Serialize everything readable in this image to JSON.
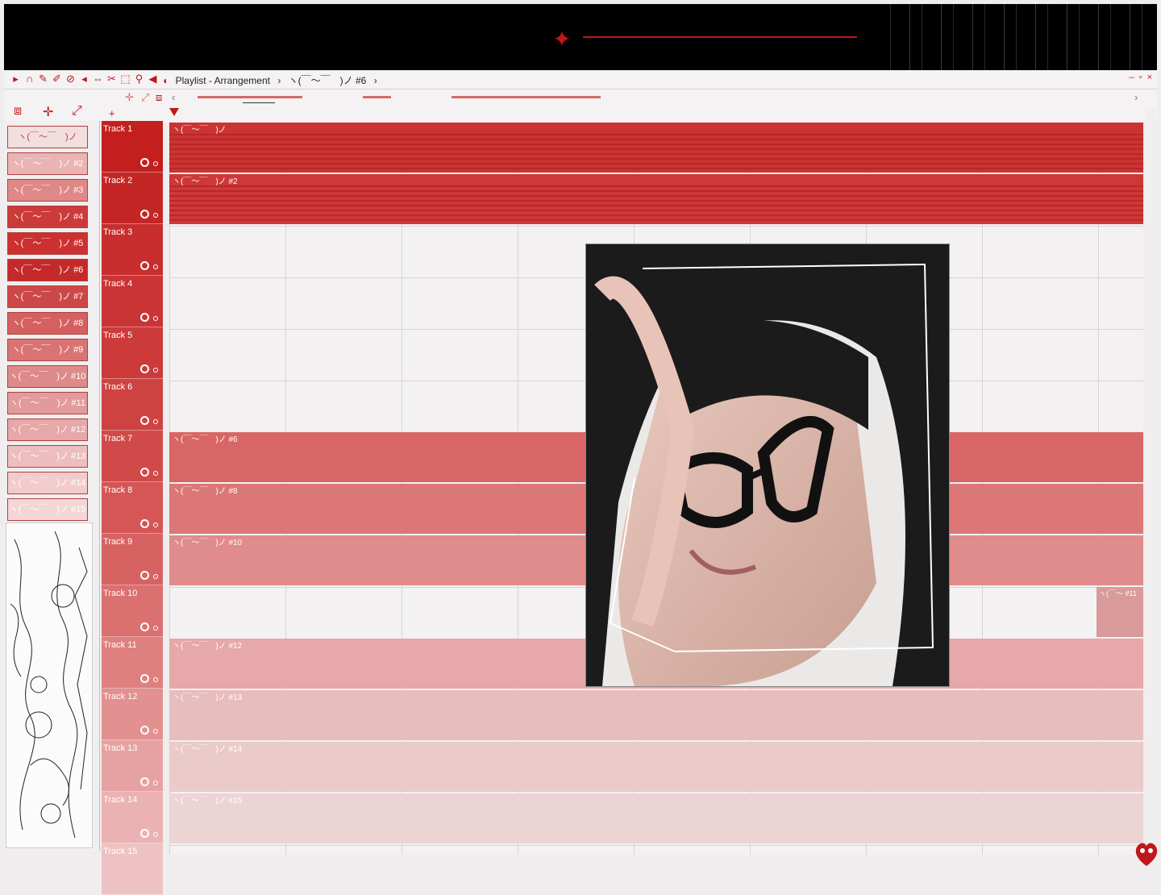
{
  "window": {
    "breadcrumb": [
      "Playlist - Arrangement",
      "›",
      "ヽ(￣～￣　)ノ #6",
      "›"
    ],
    "controls": [
      "–",
      "▫",
      "×"
    ]
  },
  "patterns": [
    {
      "label": "ヽ(￣～￣　)ノ",
      "color": "#f2dede"
    },
    {
      "label": "ヽ(￣～￣　)ノ #2",
      "color": "#eab4b4"
    },
    {
      "label": "ヽ(￣～￣　)ノ #3",
      "color": "#e08888"
    },
    {
      "label": "ヽ(￣～￣　)ノ #4",
      "color": "#cc3a3a"
    },
    {
      "label": "ヽ(￣～￣　)ノ #5",
      "color": "#cc3030"
    },
    {
      "label": "ヽ(￣～￣　)ノ #6",
      "color": "#c42a2a"
    },
    {
      "label": "ヽ(￣～￣　)ノ #7",
      "color": "#cc4848"
    },
    {
      "label": "ヽ(￣～￣　)ノ #8",
      "color": "#d46060"
    },
    {
      "label": "ヽ(￣～￣　)ノ #9",
      "color": "#da7474"
    },
    {
      "label": "ヽ(￣～￣　)ノ #10",
      "color": "#de8a8a"
    },
    {
      "label": "ヽ(￣～￣　)ノ #11",
      "color": "#e29a9a"
    },
    {
      "label": "ヽ(￣～￣　)ノ #12",
      "color": "#e6a8a8"
    },
    {
      "label": "ヽ(￣～￣　)ノ #13",
      "color": "#eebebe"
    },
    {
      "label": "ヽ(￣～￣　)ノ #14",
      "color": "#f2cccc"
    },
    {
      "label": "ヽ(￣～￣　)ノ #15",
      "color": "#f4d6d6"
    }
  ],
  "tracks": [
    {
      "label": "Track 1",
      "color": "#c41f1f"
    },
    {
      "label": "Track 2",
      "color": "#c42626"
    },
    {
      "label": "Track 3",
      "color": "#c82e2e"
    },
    {
      "label": "Track 4",
      "color": "#ca3434"
    },
    {
      "label": "Track 5",
      "color": "#cc3a3a"
    },
    {
      "label": "Track 6",
      "color": "#ce4242"
    },
    {
      "label": "Track 7",
      "color": "#d04a4a"
    },
    {
      "label": "Track 8",
      "color": "#d45656"
    },
    {
      "label": "Track 9",
      "color": "#d66262"
    },
    {
      "label": "Track 10",
      "color": "#da7070"
    },
    {
      "label": "Track 11",
      "color": "#de8080"
    },
    {
      "label": "Track 12",
      "color": "#e29090"
    },
    {
      "label": "Track 13",
      "color": "#e6a2a2"
    },
    {
      "label": "Track 14",
      "color": "#eab2b2"
    },
    {
      "label": "Track 15",
      "color": "#eec2c2"
    }
  ],
  "clips": [
    {
      "track": 0,
      "label": "ヽ(￣～￣　)ノ",
      "color": "#cc3333"
    },
    {
      "track": 1,
      "label": "ヽ(￣～￣　)ノ #2",
      "color": "#cf3838"
    },
    {
      "track": 6,
      "label": "ヽ(￣～￣　)ノ #6",
      "color": "#d86666"
    },
    {
      "track": 7,
      "label": "ヽ(￣～￣　)ノ #8",
      "color": "#dc7777"
    },
    {
      "track": 8,
      "label": "ヽ(￣～￣　)ノ #10",
      "color": "#e08c8c"
    },
    {
      "track": 10,
      "label": "ヽ(￣～￣　)ノ #12",
      "color": "#e6a8a8"
    },
    {
      "track": 11,
      "label": "ヽ(￣～￣　)ノ #13",
      "color": "#e8bdbd"
    },
    {
      "track": 12,
      "label": "ヽ(￣～￣　)ノ #14",
      "color": "#ebcaca"
    },
    {
      "track": 13,
      "label": "ヽ(￣～￣　)ノ #15",
      "color": "#ecd4d4"
    }
  ],
  "side_clip": {
    "label": "ヽ(￣～ #11"
  },
  "colors": {
    "accent": "#c0171b"
  }
}
